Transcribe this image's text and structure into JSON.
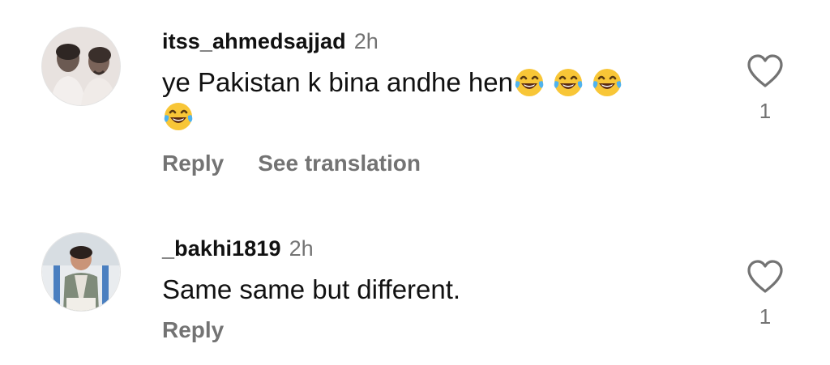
{
  "comments": [
    {
      "username": "itss_ahmedsajjad",
      "time": "2h",
      "text": "ye Pakistan k bina andhe hen",
      "emojis": [
        "face-with-tears-of-joy",
        "face-with-tears-of-joy",
        "face-with-tears-of-joy",
        "face-with-tears-of-joy"
      ],
      "reply_label": "Reply",
      "translate_label": "See translation",
      "like_count": "1",
      "like_icon": "heart-outline-icon"
    },
    {
      "username": "_bakhi1819",
      "time": "2h",
      "text": "Same same but different.",
      "reply_label": "Reply",
      "like_count": "1",
      "like_icon": "heart-outline-icon"
    }
  ],
  "colors": {
    "text_primary": "#111111",
    "text_secondary": "#737373",
    "background": "#ffffff"
  }
}
